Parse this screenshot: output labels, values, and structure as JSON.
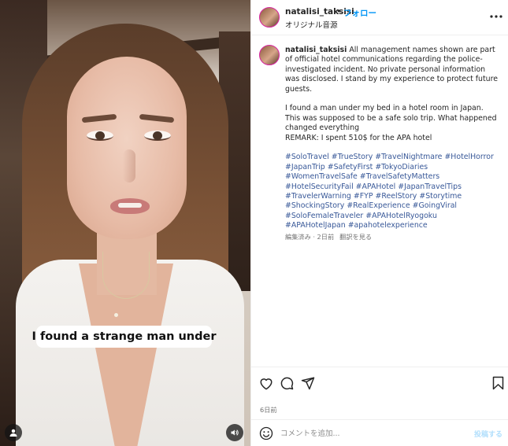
{
  "video": {
    "caption": "I found a strange man under",
    "icons": {
      "user": "user-icon",
      "sound": "speaker-icon"
    }
  },
  "header": {
    "username": "natalisi_taksisi",
    "separator": "•",
    "follow_label": "フォロー",
    "audio_label": "オリジナル音源",
    "more_icon": "more-horizontal-icon"
  },
  "post": {
    "username": "natalisi_taksisi",
    "paragraphs": [
      "All management names shown are part of official hotel communications regarding the police-investigated incident. No private personal information was disclosed. I stand by my experience to protect future guests.",
      "I found a man under my bed in a hotel room in Japan. This was supposed to be a safe solo trip. What happened changed everything",
      "REMARK: I spent 510$ for the APA hotel"
    ],
    "hashtags": [
      "#SoloTravel",
      "#TrueStory",
      "#TravelNightmare",
      "#HotelHorror",
      "#JapanTrip",
      "#SafetyFirst",
      "#TokyoDiaries",
      "#WomenTravelSafe",
      "#TravelSafetyMatters",
      "#HotelSecurityFail",
      "#APAHotel",
      "#JapanTravelTips",
      "#TravelerWarning",
      "#FYP",
      "#ReelStory",
      "#Storytime",
      "#ShockingStory",
      "#RealExperience",
      "#GoingViral",
      "#SoloFemaleTraveler",
      "#APAHotelRyogoku",
      "#APAHotelJapan",
      "#apahotelexperience"
    ],
    "edited_meta": "編集済み · 2日前",
    "see_translation": "翻訳を見る"
  },
  "actions": {
    "icons": [
      "heart-icon",
      "comment-icon",
      "share-icon",
      "bookmark-icon"
    ],
    "time_ago": "6日前"
  },
  "comment": {
    "placeholder": "コメントを追加...",
    "post_label": "投稿する"
  },
  "colors": {
    "link": "#385898",
    "follow": "#0095f6",
    "post_disabled": "#b2dffc",
    "muted": "#737373"
  }
}
